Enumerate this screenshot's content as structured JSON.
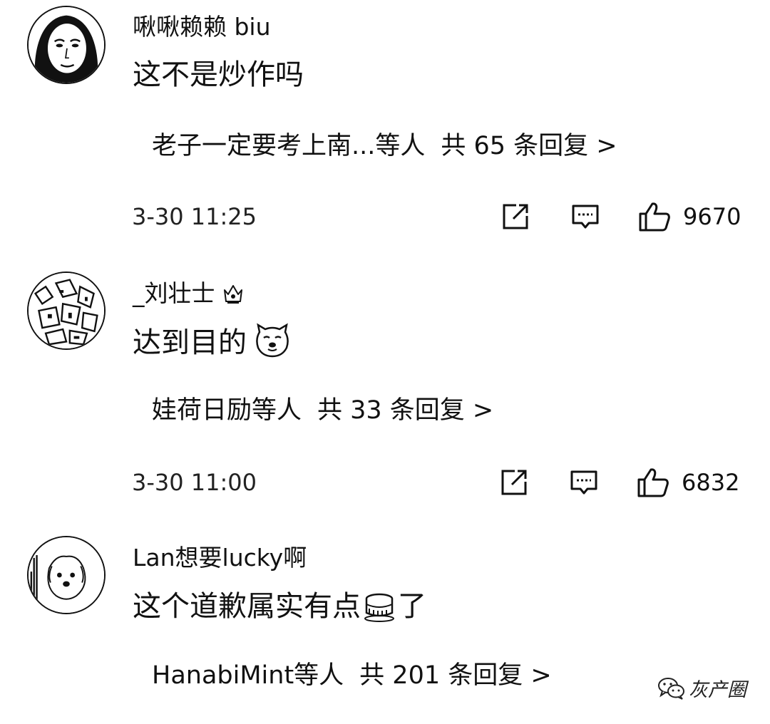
{
  "comments": [
    {
      "username": "啾啾赖赖 biu",
      "text": "这不是炒作吗",
      "replies_by": "老子一定要考上南...等人",
      "replies_count": "共 65 条回复 >",
      "time": "3-30 11:25",
      "likes": "9670",
      "avatar_icon": "woman-face-avatar"
    },
    {
      "username": "_刘壮士",
      "text": "达到目的",
      "replies_by": "娃荷日励等人",
      "replies_count": "共 33 条回复 >",
      "time": "3-30 11:00",
      "likes": "6832",
      "avatar_icon": "sketch-avatar",
      "badge_icon": "crown-badge-icon",
      "emoji_icon": "doge-emoji"
    },
    {
      "username": "Lan想要lucky啊",
      "text_before": "这个道歉属实有点",
      "text_after": "了",
      "replies_by": "HanabiMint等人",
      "replies_count": "共 201 条回复 >",
      "avatar_icon": "puppy-avatar",
      "emoji_icon": "cake-emoji"
    }
  ],
  "watermark": {
    "label": "灰产圈",
    "icon": "wechat-icon"
  }
}
